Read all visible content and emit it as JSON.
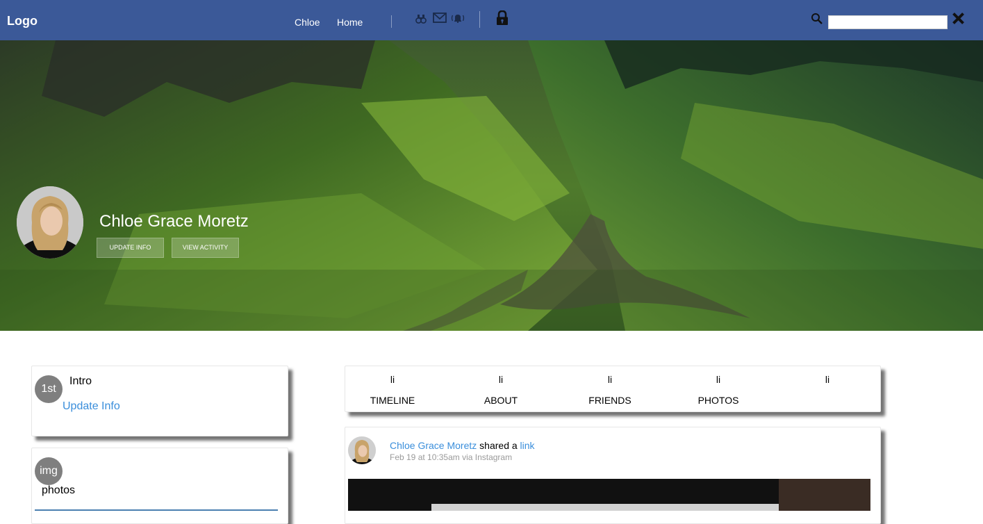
{
  "topbar": {
    "logo": "Logo",
    "nav": [
      "Chloe",
      "Home"
    ],
    "icons": [
      "binoculars-icon",
      "mail-icon",
      "notification-bell-icon",
      "lock-icon",
      "search-icon",
      "close-icon"
    ],
    "search_value": ""
  },
  "profile": {
    "name": "Chloe Grace Moretz",
    "update_info_label": "UPDATE INFO",
    "view_activity_label": "VIEW ACTIVITY"
  },
  "intro_card": {
    "badge": "1st",
    "title": "Intro",
    "link": "Update Info"
  },
  "photos_card": {
    "badge": "img",
    "title": "photos"
  },
  "tabs": [
    {
      "bullet": "li",
      "label": "TIMELINE"
    },
    {
      "bullet": "li",
      "label": "ABOUT"
    },
    {
      "bullet": "li",
      "label": "FRIENDS"
    },
    {
      "bullet": "li",
      "label": "PHOTOS"
    },
    {
      "bullet": "li",
      "label": ""
    }
  ],
  "post": {
    "author": "Chloe Grace Moretz",
    "action": " shared a ",
    "object": "link",
    "meta": "Feb 19 at 10:35am via Instagram"
  },
  "colors": {
    "topbar": "#3b5998",
    "link": "#3a8edb",
    "badge": "#7f7f7f"
  }
}
